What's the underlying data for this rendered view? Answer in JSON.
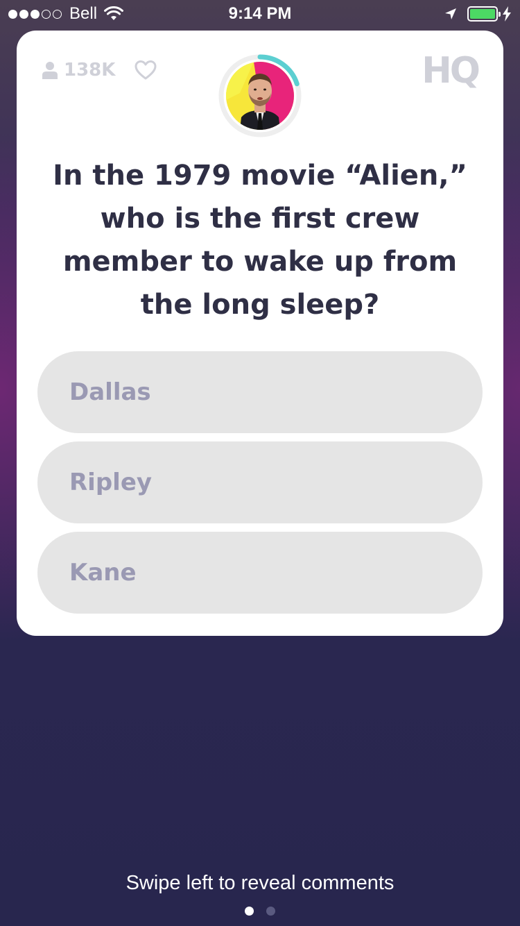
{
  "status_bar": {
    "carrier": "Bell",
    "time": "9:14 PM",
    "signal_bars_filled": 3,
    "signal_bars_total": 5,
    "battery_level": 1.0
  },
  "card": {
    "viewer_count": "138K",
    "logo_text": "HQ",
    "question": "In the 1979 movie “Alien,” who is the first crew member to wake up from the long sleep?",
    "timer_fraction_remaining": 0.2,
    "answers": [
      {
        "label": "Dallas"
      },
      {
        "label": "Ripley"
      },
      {
        "label": "Kane"
      }
    ]
  },
  "footer": {
    "hint": "Swipe left to reveal comments",
    "pages_total": 2,
    "current_page": 1
  },
  "colors": {
    "accent_timer": "#5ccfd1",
    "answer_bg": "#e5e5e5",
    "answer_text": "#9a99b3",
    "question_text": "#2f2f45",
    "muted_icon": "#cfd0d8",
    "battery": "#4cd964"
  },
  "icons": {
    "viewers": "person-icon",
    "like": "heart-icon",
    "wifi": "wifi-icon",
    "location": "location-arrow-icon",
    "charging": "bolt-icon"
  }
}
